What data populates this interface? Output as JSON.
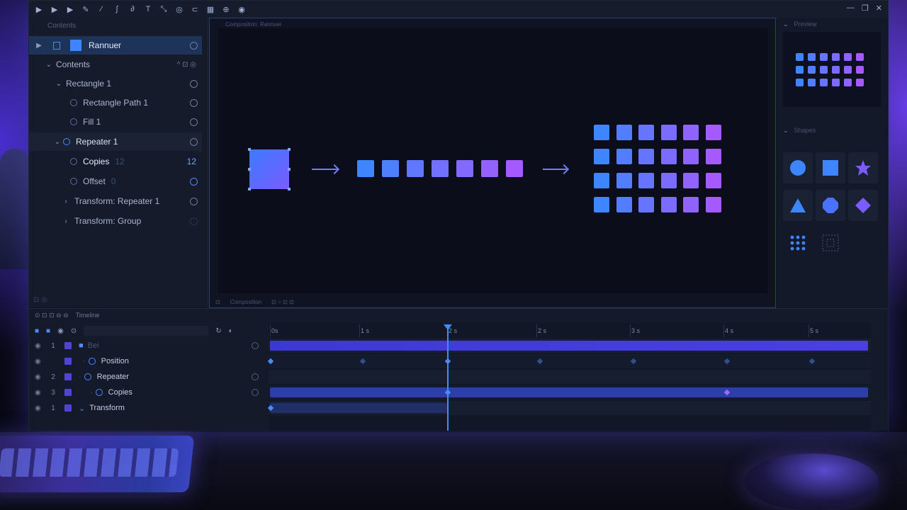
{
  "toolbar": {
    "icons": [
      "select-tool-icon",
      "play-icon",
      "step-forward-icon",
      "pen-icon",
      "brush-icon",
      "wand-icon",
      "anchor-icon",
      "text-icon",
      "transform-icon",
      "link-icon",
      "ruler-icon",
      "grid-icon",
      "zoom-icon",
      "settings-icon"
    ]
  },
  "layers": {
    "header": "Contents",
    "items": [
      {
        "label": "Rannuer"
      },
      {
        "label": "Contents"
      },
      {
        "label": "Rectangle 1"
      },
      {
        "label": "Rectangle Path 1"
      },
      {
        "label": "Fill 1"
      },
      {
        "label": "Repeater 1"
      },
      {
        "label": "Copies",
        "ghost": "12",
        "value": "12"
      },
      {
        "label": "Offset",
        "ghost": "0"
      },
      {
        "label": "Transform: Repeater 1"
      },
      {
        "label": "Transform: Group"
      }
    ]
  },
  "viewport": {
    "label": "Composition: Rannuer",
    "footer": "Composition"
  },
  "right_panel": {
    "preview_header": "Preview",
    "shapes_header": "Shapes"
  },
  "timeline": {
    "header": "Timeline",
    "ticks": [
      "0s",
      "1 s",
      "2 s",
      "2 s",
      "3 s",
      "4 s",
      "5 s"
    ],
    "rows": [
      {
        "index": "1",
        "label": "Bei"
      },
      {
        "index": "",
        "label": "Position"
      },
      {
        "index": "2",
        "label": "Repeater"
      },
      {
        "index": "3",
        "label": "Copies"
      },
      {
        "index": "1",
        "label": "Transform"
      }
    ]
  },
  "colors": {
    "accent": "#3f8bff",
    "violet": "#8a5cff",
    "panel": "#151b2b"
  }
}
